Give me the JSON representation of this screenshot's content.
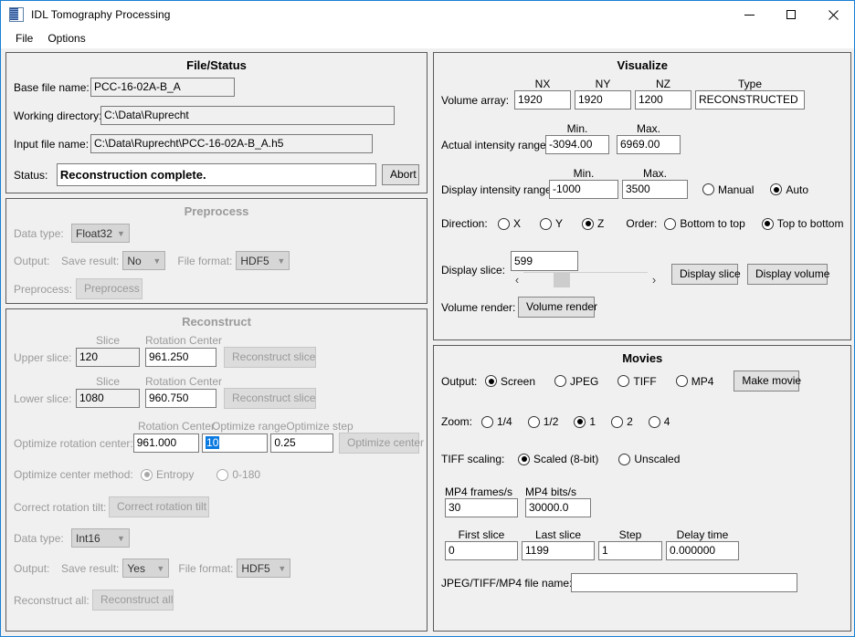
{
  "window": {
    "title": "IDL Tomography Processing",
    "icon": "idl-app-icon",
    "minimize": "minimize-icon",
    "maximize": "maximize-icon",
    "close": "close-icon",
    "accent_color": "#1a7fd4",
    "bg_color": "#f0f0f0"
  },
  "menubar": {
    "items": [
      {
        "label": "File"
      },
      {
        "label": "Options"
      }
    ]
  },
  "file_status": {
    "title": "File/Status",
    "base_file_label": "Base file name:",
    "base_file_value": "PCC-16-02A-B_A",
    "working_dir_label": "Working directory:",
    "working_dir_value": "C:\\Data\\Ruprecht",
    "input_file_label": "Input file name:",
    "input_file_value": "C:\\Data\\Ruprecht\\PCC-16-02A-B_A.h5",
    "status_label": "Status:",
    "status_value": "Reconstruction complete.",
    "abort_label": "Abort"
  },
  "preprocess": {
    "title": "Preprocess",
    "data_type_label": "Data type:",
    "data_type_value": "Float32",
    "output_label": "Output:",
    "save_result_label": "Save result:",
    "save_result_value": "No",
    "file_format_label": "File format:",
    "file_format_value": "HDF5",
    "preprocess_label": "Preprocess:",
    "preprocess_button": "Preprocess"
  },
  "reconstruct": {
    "title": "Reconstruct",
    "slice_header": "Slice",
    "rotation_center_header": "Rotation Center",
    "upper_slice_label": "Upper slice:",
    "upper_slice_value": "120",
    "upper_rotation_center": "961.250",
    "upper_reconstruct_button": "Reconstruct slice",
    "lower_slice_label": "Lower slice:",
    "lower_slice_value": "1080",
    "lower_rotation_center": "960.750",
    "lower_reconstruct_button": "Reconstruct slice",
    "optimize_label": "Optimize rotation center:",
    "optimize_rc_header": "Rotation Center",
    "optimize_range_header": "Optimize range",
    "optimize_step_header": "Optimize step",
    "optimize_rc_value": "961.000",
    "optimize_range_value": "10",
    "optimize_step_value": "0.25",
    "optimize_center_button": "Optimize center",
    "method_label": "Optimize center method:",
    "method_entropy": "Entropy",
    "method_0_180": "0-180",
    "method_selected": "Entropy",
    "tilt_label": "Correct rotation tilt:",
    "tilt_button": "Correct rotation tilt",
    "data_type_label": "Data type:",
    "data_type_value": "Int16",
    "output_label": "Output:",
    "save_result_label": "Save result:",
    "save_result_value": "Yes",
    "file_format_label": "File format:",
    "file_format_value": "HDF5",
    "reconstruct_all_label": "Reconstruct all:",
    "reconstruct_all_button": "Reconstruct all"
  },
  "visualize": {
    "title": "Visualize",
    "nx_header": "NX",
    "ny_header": "NY",
    "nz_header": "NZ",
    "type_header": "Type",
    "volume_array_label": "Volume array:",
    "nx_value": "1920",
    "ny_value": "1920",
    "nz_value": "1200",
    "type_value": "RECONSTRUCTED",
    "min_header": "Min.",
    "max_header": "Max.",
    "actual_label": "Actual intensity range:",
    "actual_min": "-3094.00",
    "actual_max": "6969.00",
    "display_label": "Display intensity range:",
    "display_min": "-1000",
    "display_max": "3500",
    "manual_label": "Manual",
    "auto_label": "Auto",
    "intensity_mode": "Auto",
    "direction_label": "Direction:",
    "direction_x": "X",
    "direction_y": "Y",
    "direction_z": "Z",
    "direction_selected": "Z",
    "order_label": "Order:",
    "order_bottom": "Bottom to top",
    "order_top": "Top to bottom",
    "order_selected": "Top to bottom",
    "display_slice_label": "Display slice:",
    "display_slice_value": "599",
    "slider_left": "‹",
    "slider_right": "›",
    "display_slice_button": "Display slice",
    "display_volume_button": "Display volume",
    "volume_render_label": "Volume render:",
    "volume_render_button": "Volume render"
  },
  "movies": {
    "title": "Movies",
    "output_label": "Output:",
    "output_options": [
      "Screen",
      "JPEG",
      "TIFF",
      "MP4"
    ],
    "output_selected": "Screen",
    "make_movie_button": "Make movie",
    "zoom_label": "Zoom:",
    "zoom_options": [
      "1/4",
      "1/2",
      "1",
      "2",
      "4"
    ],
    "zoom_selected": "1",
    "tiff_scaling_label": "TIFF scaling:",
    "tiff_scaled": "Scaled (8-bit)",
    "tiff_unscaled": "Unscaled",
    "tiff_selected": "Scaled (8-bit)",
    "mp4_fps_header": "MP4 frames/s",
    "mp4_fps_value": "30",
    "mp4_bps_header": "MP4 bits/s",
    "mp4_bps_value": "30000.0",
    "first_slice_header": "First slice",
    "first_slice_value": "0",
    "last_slice_header": "Last slice",
    "last_slice_value": "1199",
    "step_header": "Step",
    "step_value": "1",
    "delay_header": "Delay time",
    "delay_value": "0.000000",
    "filename_label": "JPEG/TIFF/MP4 file name:",
    "filename_value": ""
  }
}
